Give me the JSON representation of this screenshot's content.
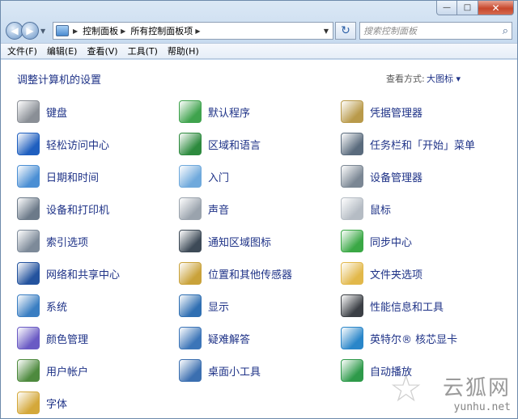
{
  "window": {
    "minimize_glyph": "—",
    "maximize_glyph": "□",
    "close_glyph": "✕"
  },
  "navigation": {
    "back_glyph": "◀",
    "forward_glyph": "▶",
    "breadcrumbs": [
      "控制面板",
      "所有控制面板项"
    ],
    "search_placeholder": "搜索控制面板",
    "refresh_glyph": "↻"
  },
  "menu": [
    "文件(F)",
    "编辑(E)",
    "查看(V)",
    "工具(T)",
    "帮助(H)"
  ],
  "header": {
    "title": "调整计算机的设置",
    "view_by_label": "查看方式:",
    "view_by_value": "大图标 ▾"
  },
  "items": [
    {
      "label": "键盘",
      "icon": "keyboard-icon",
      "color": "#8a8f96"
    },
    {
      "label": "默认程序",
      "icon": "default-programs-icon",
      "color": "#3fa34d"
    },
    {
      "label": "凭据管理器",
      "icon": "credential-manager-icon",
      "color": "#b99a4a"
    },
    {
      "label": "轻松访问中心",
      "icon": "ease-of-access-icon",
      "color": "#1f5fbf"
    },
    {
      "label": "区域和语言",
      "icon": "region-language-icon",
      "color": "#2d8a3e"
    },
    {
      "label": "任务栏和「开始」菜单",
      "icon": "taskbar-icon",
      "color": "#5a6b7d"
    },
    {
      "label": "日期和时间",
      "icon": "date-time-icon",
      "color": "#4b8fd4"
    },
    {
      "label": "入门",
      "icon": "getting-started-icon",
      "color": "#6fa9dc"
    },
    {
      "label": "设备管理器",
      "icon": "device-manager-icon",
      "color": "#7b8794"
    },
    {
      "label": "设备和打印机",
      "icon": "devices-printers-icon",
      "color": "#6c7a89"
    },
    {
      "label": "声音",
      "icon": "sound-icon",
      "color": "#9aa3ad"
    },
    {
      "label": "鼠标",
      "icon": "mouse-icon",
      "color": "#b5bcc4"
    },
    {
      "label": "索引选项",
      "icon": "indexing-options-icon",
      "color": "#7d8a99"
    },
    {
      "label": "通知区域图标",
      "icon": "notification-area-icon",
      "color": "#3d4a57"
    },
    {
      "label": "同步中心",
      "icon": "sync-center-icon",
      "color": "#3aa845"
    },
    {
      "label": "网络和共享中心",
      "icon": "network-sharing-icon",
      "color": "#24539e"
    },
    {
      "label": "位置和其他传感器",
      "icon": "location-sensors-icon",
      "color": "#c9a23a"
    },
    {
      "label": "文件夹选项",
      "icon": "folder-options-icon",
      "color": "#e2b84a"
    },
    {
      "label": "系统",
      "icon": "system-icon",
      "color": "#3a7ec2"
    },
    {
      "label": "显示",
      "icon": "display-icon",
      "color": "#2f6fb2"
    },
    {
      "label": "性能信息和工具",
      "icon": "performance-icon",
      "color": "#3b3f45"
    },
    {
      "label": "颜色管理",
      "icon": "color-management-icon",
      "color": "#6a5ac4"
    },
    {
      "label": "疑难解答",
      "icon": "troubleshooting-icon",
      "color": "#3c75b8"
    },
    {
      "label": "英特尔® 核芯显卡",
      "icon": "intel-graphics-icon",
      "color": "#2a86c9"
    },
    {
      "label": "用户帐户",
      "icon": "user-accounts-icon",
      "color": "#4e8a3e"
    },
    {
      "label": "桌面小工具",
      "icon": "desktop-gadgets-icon",
      "color": "#3b6fb0"
    },
    {
      "label": "自动播放",
      "icon": "autoplay-icon",
      "color": "#2e9a4a"
    },
    {
      "label": "字体",
      "icon": "fonts-icon",
      "color": "#d4a83a"
    }
  ],
  "watermark": {
    "text": "云狐网",
    "url": "yunhu.net"
  }
}
